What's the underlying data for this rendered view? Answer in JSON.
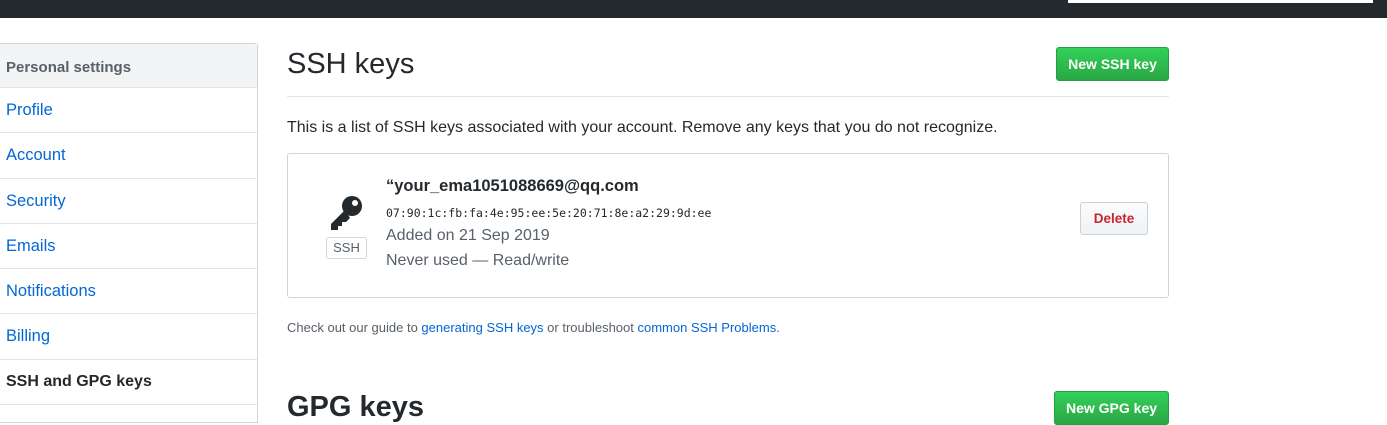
{
  "sidebar": {
    "heading": "Personal settings",
    "items": [
      {
        "label": "Profile"
      },
      {
        "label": "Account"
      },
      {
        "label": "Security"
      },
      {
        "label": "Emails"
      },
      {
        "label": "Notifications"
      },
      {
        "label": "Billing"
      },
      {
        "label": "SSH and GPG keys"
      }
    ]
  },
  "ssh": {
    "title": "SSH keys",
    "new_button": "New SSH key",
    "intro": "This is a list of SSH keys associated with your account. Remove any keys that you do not recognize.",
    "key": {
      "icon": "key-icon",
      "badge": "SSH",
      "title": "“your_ema1051088669@qq.com",
      "fingerprint": "07:90:1c:fb:fa:4e:95:ee:5e:20:71:8e:a2:29:9d:ee",
      "added": "Added on 21 Sep 2019",
      "usage": "Never used — Read/write",
      "delete_button": "Delete"
    },
    "guide": {
      "prefix": "Check out our guide to ",
      "link1": "generating SSH keys",
      "middle": " or troubleshoot ",
      "link2": "common SSH Problems",
      "suffix": "."
    }
  },
  "gpg": {
    "title": "GPG keys",
    "new_button": "New GPG key"
  },
  "colors": {
    "topbar": "#24292e",
    "link": "#0366d6",
    "primary": "#28a745",
    "danger": "#cb2431"
  }
}
